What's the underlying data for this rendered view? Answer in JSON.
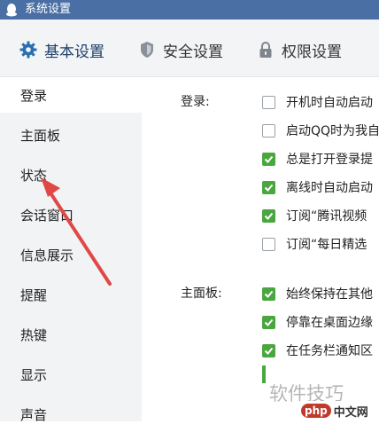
{
  "window": {
    "title": "系统设置"
  },
  "tabs": [
    {
      "label": "基本设置",
      "icon": "gear-icon",
      "active": true
    },
    {
      "label": "安全设置",
      "icon": "shield-icon"
    },
    {
      "label": "权限设置",
      "icon": "lock-icon"
    }
  ],
  "sidebar": {
    "items": [
      {
        "label": "登录",
        "active": true
      },
      {
        "label": "主面板"
      },
      {
        "label": "状态"
      },
      {
        "label": "会话窗口"
      },
      {
        "label": "信息展示"
      },
      {
        "label": "提醒"
      },
      {
        "label": "热键"
      },
      {
        "label": "显示"
      },
      {
        "label": "声音"
      }
    ]
  },
  "sections": {
    "login": {
      "label": "登录:",
      "options": [
        {
          "text": "开机时自动启动",
          "checked": false
        },
        {
          "text": "启动QQ时为我自",
          "checked": false
        },
        {
          "text": "总是打开登录提",
          "checked": true
        },
        {
          "text": "离线时自动启动",
          "checked": true
        },
        {
          "text": "订阅“腾讯视频",
          "checked": true
        },
        {
          "text": "订阅“每日精选",
          "checked": false
        }
      ]
    },
    "panel": {
      "label": "主面板:",
      "options": [
        {
          "text": "始终保持在其他",
          "checked": true
        },
        {
          "text": "停靠在桌面边缘",
          "checked": true
        },
        {
          "text": "在任务栏通知区",
          "checked": true
        }
      ]
    }
  },
  "watermark": {
    "text": "软件技巧",
    "logo_badge": "php",
    "logo_text": "中文网"
  },
  "colors": {
    "titlebar": "#4a6fa5",
    "check_green": "#4aa63f",
    "arrow": "#e04848"
  }
}
